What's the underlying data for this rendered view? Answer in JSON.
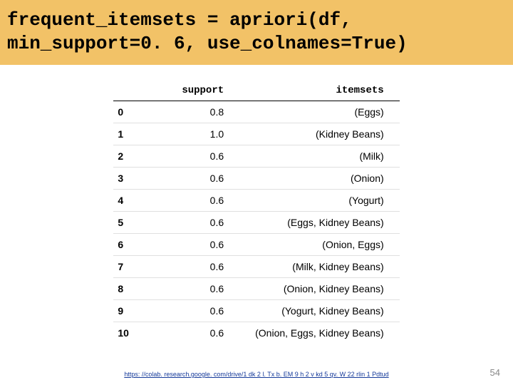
{
  "code": {
    "line1": "frequent_itemsets = apriori(df,",
    "line2": "min_support=0. 6, use_colnames=True)"
  },
  "table": {
    "headers": {
      "index": "",
      "support": "support",
      "itemsets": "itemsets"
    },
    "rows": [
      {
        "idx": "0",
        "support": "0.8",
        "itemsets": "(Eggs)"
      },
      {
        "idx": "1",
        "support": "1.0",
        "itemsets": "(Kidney Beans)"
      },
      {
        "idx": "2",
        "support": "0.6",
        "itemsets": "(Milk)"
      },
      {
        "idx": "3",
        "support": "0.6",
        "itemsets": "(Onion)"
      },
      {
        "idx": "4",
        "support": "0.6",
        "itemsets": "(Yogurt)"
      },
      {
        "idx": "5",
        "support": "0.6",
        "itemsets": "(Eggs, Kidney Beans)"
      },
      {
        "idx": "6",
        "support": "0.6",
        "itemsets": "(Onion, Eggs)"
      },
      {
        "idx": "7",
        "support": "0.6",
        "itemsets": "(Milk, Kidney Beans)"
      },
      {
        "idx": "8",
        "support": "0.6",
        "itemsets": "(Onion, Kidney Beans)"
      },
      {
        "idx": "9",
        "support": "0.6",
        "itemsets": "(Yogurt, Kidney Beans)"
      },
      {
        "idx": "10",
        "support": "0.6",
        "itemsets": "(Onion, Eggs, Kidney Beans)"
      }
    ]
  },
  "footer": {
    "link_text": "https: //colab. research.google. com/drive/1 dk 2 l. Tx b. EM 9 h 2 v kd 5 qv. W 22 rlin 1 Pdtud",
    "link_href": "https://colab.research.google.com/drive/1dk2lTxbEM9h2vkd5qvW22rlin1Pdtud"
  },
  "page_number": "54",
  "chart_data": {
    "type": "table",
    "title": "Output of apriori(df, min_support=0.6, use_colnames=True)",
    "columns": [
      "support",
      "itemsets"
    ],
    "rows": [
      [
        0.8,
        "(Eggs)"
      ],
      [
        1.0,
        "(Kidney Beans)"
      ],
      [
        0.6,
        "(Milk)"
      ],
      [
        0.6,
        "(Onion)"
      ],
      [
        0.6,
        "(Yogurt)"
      ],
      [
        0.6,
        "(Eggs, Kidney Beans)"
      ],
      [
        0.6,
        "(Onion, Eggs)"
      ],
      [
        0.6,
        "(Milk, Kidney Beans)"
      ],
      [
        0.6,
        "(Onion, Kidney Beans)"
      ],
      [
        0.6,
        "(Yogurt, Kidney Beans)"
      ],
      [
        0.6,
        "(Onion, Eggs, Kidney Beans)"
      ]
    ]
  }
}
